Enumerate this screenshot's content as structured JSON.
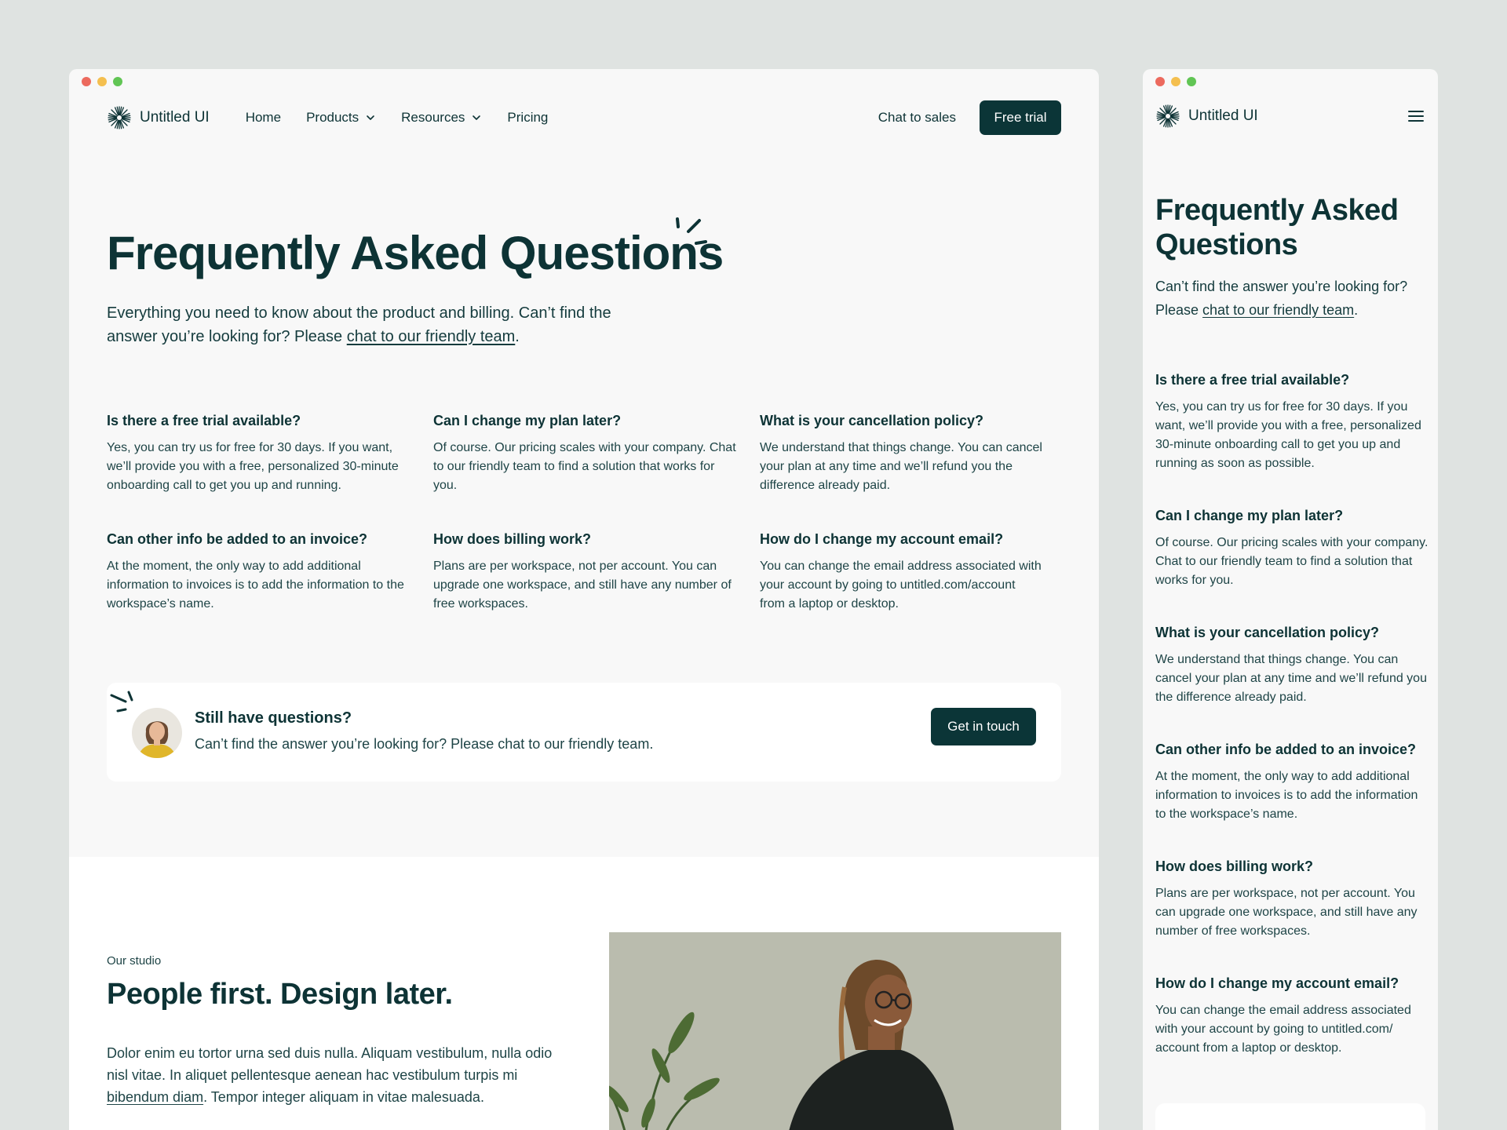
{
  "brand": {
    "name": "Untitled UI"
  },
  "nav": {
    "items": [
      {
        "label": "Home",
        "has_dropdown": false
      },
      {
        "label": "Products",
        "has_dropdown": true
      },
      {
        "label": "Resources",
        "has_dropdown": true
      },
      {
        "label": "Pricing",
        "has_dropdown": false
      }
    ],
    "chat_label": "Chat to sales",
    "trial_label": "Free trial"
  },
  "hero": {
    "title": "Frequently Asked Questions",
    "subtitle_before": "Everything you need to know about the product and billing. Can’t find the answer you’re looking for? Please ",
    "subtitle_link": "chat to our friendly team",
    "subtitle_after": "."
  },
  "faqs": [
    {
      "q": "Is there a free trial available?",
      "a": "Yes, you can try us for free for 30 days. If you want, we’ll provide you with a free, personalized 30-minute onboarding call to get you up and running."
    },
    {
      "q": "Can I change my plan later?",
      "a": "Of course. Our pricing scales with your company. Chat to our friendly team to find a solution that works for you."
    },
    {
      "q": "What is your cancellation policy?",
      "a": "We understand that things change. You can cancel your plan at any time and we’ll refund you the difference already paid."
    },
    {
      "q": "Can other info be added to an invoice?",
      "a": "At the moment, the only way to add additional information to invoices is to add the information to the workspace’s name."
    },
    {
      "q": "How does billing work?",
      "a": "Plans are per workspace, not per account. You can upgrade one workspace, and still have any number of free workspaces."
    },
    {
      "q": "How do I change my account email?",
      "a": "You can change the email address associated with your account by going to untitled.com/account from a laptop or desktop."
    }
  ],
  "mobile_faqs": [
    {
      "q": "Is there a free trial available?",
      "a": "Yes, you can try us for free for 30 days. If you want, we’ll provide you with a free, personalized 30-minute onboarding call to get you up and running as soon as possible."
    },
    {
      "q": "Can I change my plan later?",
      "a": "Of course. Our pricing scales with your company. Chat to our friendly team to find a solution that works for you."
    },
    {
      "q": "What is your cancellation policy?",
      "a": "We understand that things change. You can cancel your plan at any time and we’ll refund you the difference already paid."
    },
    {
      "q": "Can other info be added to an invoice?",
      "a": "At the moment, the only way to add additional information to invoices is to add the information to the workspace’s name."
    },
    {
      "q": "How does billing work?",
      "a": "Plans are per workspace, not per account. You can upgrade one workspace, and still have any number of free workspaces."
    },
    {
      "q": "How do I change my account email?",
      "a": "You can change the email address associated with your account by going to untitled.com/ account from a laptop or desktop."
    }
  ],
  "cta": {
    "title": "Still have questions?",
    "text": "Can’t find the answer you’re looking for? Please chat to our friendly team.",
    "button": "Get in touch"
  },
  "studio": {
    "eyebrow": "Our studio",
    "title": "People first. Design later.",
    "body_before": "Dolor enim eu tortor urna sed duis nulla. Aliquam vestibulum, nulla odio nisl vitae. In aliquet pellentesque aenean hac vestibulum turpis mi ",
    "body_link": "bibendum diam",
    "body_after": ". Tempor integer aliquam in vitae malesuada."
  },
  "mobile": {
    "title": "Frequently Asked Questions",
    "subtitle_before": "Can’t find the answer you’re looking for? Please ",
    "subtitle_link": "chat to our friendly team",
    "subtitle_after": "."
  },
  "icons": {
    "logo": "starburst-logo-icon",
    "dropdown": "chevron-down-icon",
    "menu": "hamburger-menu-icon"
  },
  "colors": {
    "background": "#dfe3e1",
    "surface": "#f8f8f8",
    "primary": "#0b3537",
    "text": "#0d3335",
    "window_dots": [
      "#ec6a5e",
      "#f4bf4f",
      "#61c554"
    ]
  }
}
